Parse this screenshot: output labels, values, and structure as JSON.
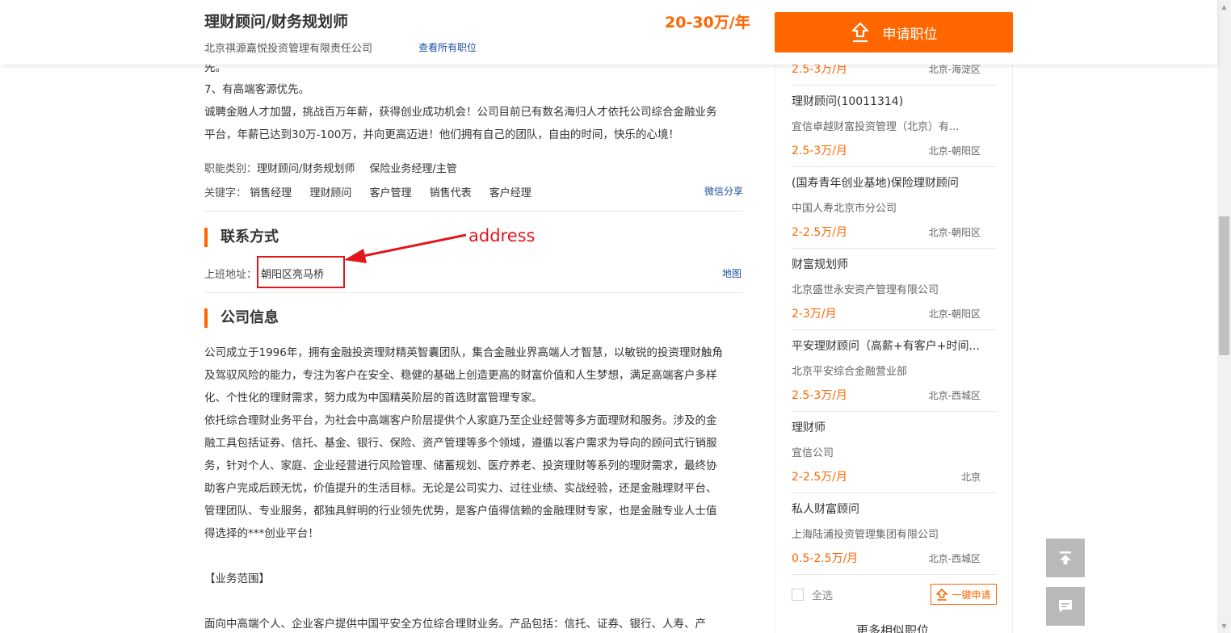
{
  "header": {
    "job_title": "理财顾问/财务规划师",
    "company": "北京祺源嘉悦投资管理有限责任公司",
    "view_all": "查看所有职位",
    "salary": "20-30万/年",
    "apply_label": "申请职位"
  },
  "description": {
    "line0": "先。",
    "line1": "7、有高端客源优先。",
    "line2": "诚聘金融人才加盟，挑战百万年薪，获得创业成功机会！公司目前已有数名海归人才依托公司综合金融业务",
    "line3": "平台，年薪已达到30万-100万，并向更高迈进！他们拥有自己的团队，自由的时间，快乐的心境！"
  },
  "job_meta": {
    "category_label": "职能类别：",
    "categories": [
      "理财顾问/财务规划师",
      "保险业务经理/主管"
    ],
    "keyword_label": "关键字：",
    "keywords": [
      "销售经理",
      "理财顾问",
      "客户管理",
      "销售代表",
      "客户经理"
    ],
    "wechat_share": "微信分享"
  },
  "contact": {
    "title": "联系方式",
    "address_label": "上班地址：",
    "address": "朝阳区亮马桥",
    "map_link": "地图",
    "annotation": "address"
  },
  "company_info": {
    "title": "公司信息",
    "lines": [
      "公司成立于1996年，拥有金融投资理财精英智囊团队，集合金融业界高端人才智慧，以敏锐的投资理财触角",
      "及驾驭风险的能力，专注为客户在安全、稳健的基础上创造更高的财富价值和人生梦想，满足高端客户多样",
      "化、个性化的理财需求，努力成为中国精英阶层的首选财富管理专家。",
      "依托综合理财业务平台，为社会中高端客户阶层提供个人家庭乃至企业经营等多方面理财和服务。涉及的金",
      "融工具包括证券、信托、基金、银行、保险、资产管理等多个领域，遵循以客户需求为导向的顾问式行销服",
      "务，针对个人、家庭、企业经营进行风险管理、储蓄规划、医疗养老、投资理财等系列的理财需求，最终协",
      "助客户完成后顾无忧，价值提升的生活目标。无论是公司实力、过往业绩、实战经验，还是金融理财平台、",
      "管理团队、专业服务，都独具鲜明的行业领先优势，是客户值得信赖的金融理财专家，也是金融专业人士值",
      "得选择的***创业平台！"
    ],
    "scope_title": "【业务范围】",
    "scope_line": "面向中高端个人、企业客户提供中国平安全方位综合理财业务。产品包括：信托、证券、银行、人寿、产"
  },
  "sidebar": {
    "first_partial": {
      "salary": "2.5-3万/月",
      "location": "北京-海淀区"
    },
    "jobs": [
      {
        "title": "理财顾问(10011314)",
        "company": "宜信卓越财富投资管理（北京）有...",
        "salary": "2.5-3万/月",
        "location": "北京-朝阳区"
      },
      {
        "title": "(国寿青年创业基地)保险理财顾问",
        "company": "中国人寿北京市分公司",
        "salary": "2-2.5万/月",
        "location": "北京-朝阳区"
      },
      {
        "title": "财富规划师",
        "company": "北京盛世永安资产管理有限公司",
        "salary": "2-3万/月",
        "location": "北京-朝阳区"
      },
      {
        "title": "平安理财顾问（高薪+有客户+时间...",
        "company": "北京平安综合金融营业部",
        "salary": "2.5-3万/月",
        "location": "北京-西城区"
      },
      {
        "title": "理财师",
        "company": "宜信公司",
        "salary": "2-2.5万/月",
        "location": "北京"
      },
      {
        "title": "私人财富顾问",
        "company": "上海陆浦投资管理集团有限公司",
        "salary": "0.5-2.5万/月",
        "location": "北京-西城区"
      }
    ],
    "select_all": "全选",
    "one_click_apply": "一键申请",
    "more_similar": "更多相似职位"
  },
  "colors": {
    "accent": "#ff6600",
    "link": "#1b4f9c",
    "annotation": "#e0161b"
  }
}
